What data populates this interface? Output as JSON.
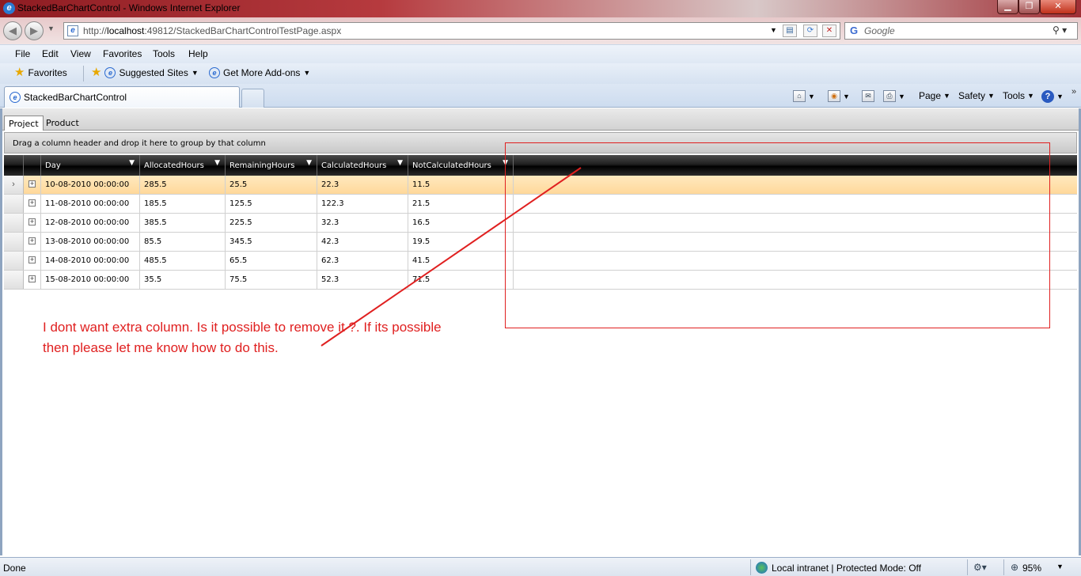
{
  "window": {
    "title": "StackedBarChartControl - Windows Internet Explorer"
  },
  "nav": {
    "address_prefix": "http://",
    "address_host": "localhost",
    "address_rest": ":49812/StackedBarChartControlTestPage.aspx",
    "search_placeholder": "Google"
  },
  "menu": [
    "File",
    "Edit",
    "View",
    "Favorites",
    "Tools",
    "Help"
  ],
  "favorites": {
    "favorites_label": "Favorites",
    "suggested_label": "Suggested Sites",
    "addons_label": "Get More Add-ons"
  },
  "tab": {
    "label": "StackedBarChartControl"
  },
  "commands": {
    "page": "Page",
    "safety": "Safety",
    "tools": "Tools"
  },
  "app_tabs": [
    "Project",
    "Product"
  ],
  "group_panel_text": "Drag a column header and drop it here to group by that column",
  "grid": {
    "columns": [
      "Day",
      "AllocatedHours",
      "RemainingHours",
      "CalculatedHours",
      "NotCalculatedHours"
    ],
    "rows": [
      [
        "10-08-2010 00:00:00",
        "285.5",
        "25.5",
        "22.3",
        "11.5"
      ],
      [
        "11-08-2010 00:00:00",
        "185.5",
        "125.5",
        "122.3",
        "21.5"
      ],
      [
        "12-08-2010 00:00:00",
        "385.5",
        "225.5",
        "32.3",
        "16.5"
      ],
      [
        "13-08-2010 00:00:00",
        "85.5",
        "345.5",
        "42.3",
        "19.5"
      ],
      [
        "14-08-2010 00:00:00",
        "485.5",
        "65.5",
        "62.3",
        "41.5"
      ],
      [
        "15-08-2010 00:00:00",
        "35.5",
        "75.5",
        "52.3",
        "71.5"
      ]
    ],
    "selected_row": 0
  },
  "annotation": {
    "line1": "I dont want extra column. Is it possible to remove it ?. If its possible",
    "line2": "then please let me know how to do this.",
    "color": "#e02020"
  },
  "status": {
    "left": "Done",
    "zone": "Local intranet | Protected Mode: Off",
    "zoom": "95%"
  }
}
